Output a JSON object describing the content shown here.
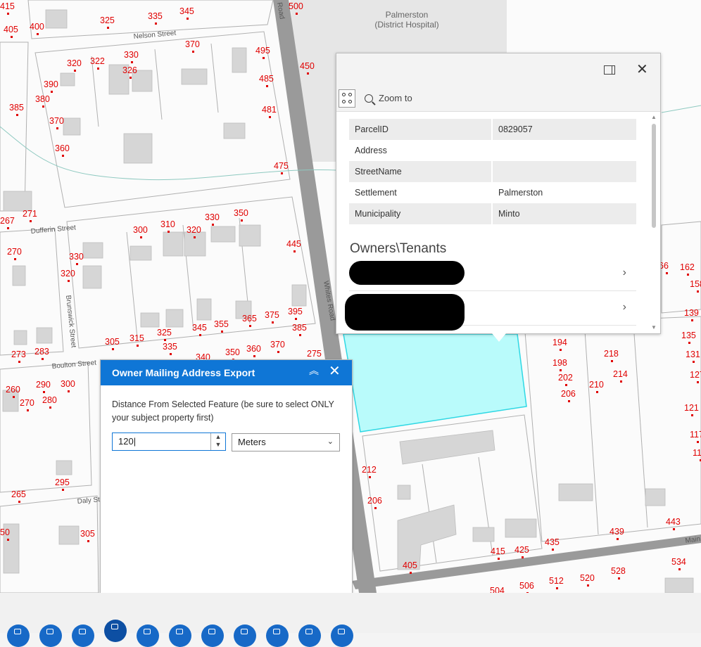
{
  "map": {
    "hospital_label": [
      "Palmerston",
      "(District Hospital)"
    ],
    "road_labels": [
      {
        "text": "Nelson Street"
      },
      {
        "text": "Dufferin Street"
      },
      {
        "text": "Brunswick Street"
      },
      {
        "text": "Boulton Street"
      },
      {
        "text": "Daly St"
      },
      {
        "text": "Whites Road"
      },
      {
        "text": "Road"
      },
      {
        "text": "Main"
      }
    ],
    "address_labels": [
      "415",
      "405",
      "400",
      "325",
      "335",
      "345",
      "500",
      "370",
      "495",
      "320",
      "322",
      "330",
      "326",
      "390",
      "485",
      "380",
      "385",
      "481",
      "370",
      "360",
      "475",
      "450",
      "267",
      "271",
      "270",
      "330",
      "300",
      "310",
      "320",
      "330",
      "350",
      "445",
      "320",
      "305",
      "315",
      "325",
      "335",
      "345",
      "355",
      "365",
      "375",
      "395",
      "385",
      "273",
      "283",
      "340",
      "350",
      "360",
      "370",
      "275",
      "260",
      "290",
      "300",
      "270",
      "280",
      "295",
      "265",
      "305",
      "50",
      "212",
      "206",
      "405",
      "415",
      "425",
      "435",
      "439",
      "443",
      "534",
      "504",
      "506",
      "512",
      "520",
      "528",
      "194",
      "198",
      "202",
      "206",
      "210",
      "214",
      "218",
      "66",
      "162",
      "158",
      "139",
      "135",
      "131",
      "127",
      "121",
      "117",
      "11"
    ]
  },
  "popup": {
    "zoom_label": "Zoom to",
    "attributes": [
      {
        "key": "ParcelID",
        "value": "0829057"
      },
      {
        "key": "Address",
        "value": ""
      },
      {
        "key": "StreetName",
        "value": ""
      },
      {
        "key": "Settlement",
        "value": "Palmerston"
      },
      {
        "key": "Municipality",
        "value": "Minto"
      }
    ],
    "section_title": "Owners\\Tenants"
  },
  "widget": {
    "title": "Owner Mailing Address Export",
    "description": "Distance From Selected Feature (be sure to select ONLY your subject property first)",
    "distance_value": "120",
    "unit": "Meters"
  },
  "colors": {
    "accent": "#0f76d6",
    "selection": "#b9fbfb",
    "address": "#e00000"
  }
}
